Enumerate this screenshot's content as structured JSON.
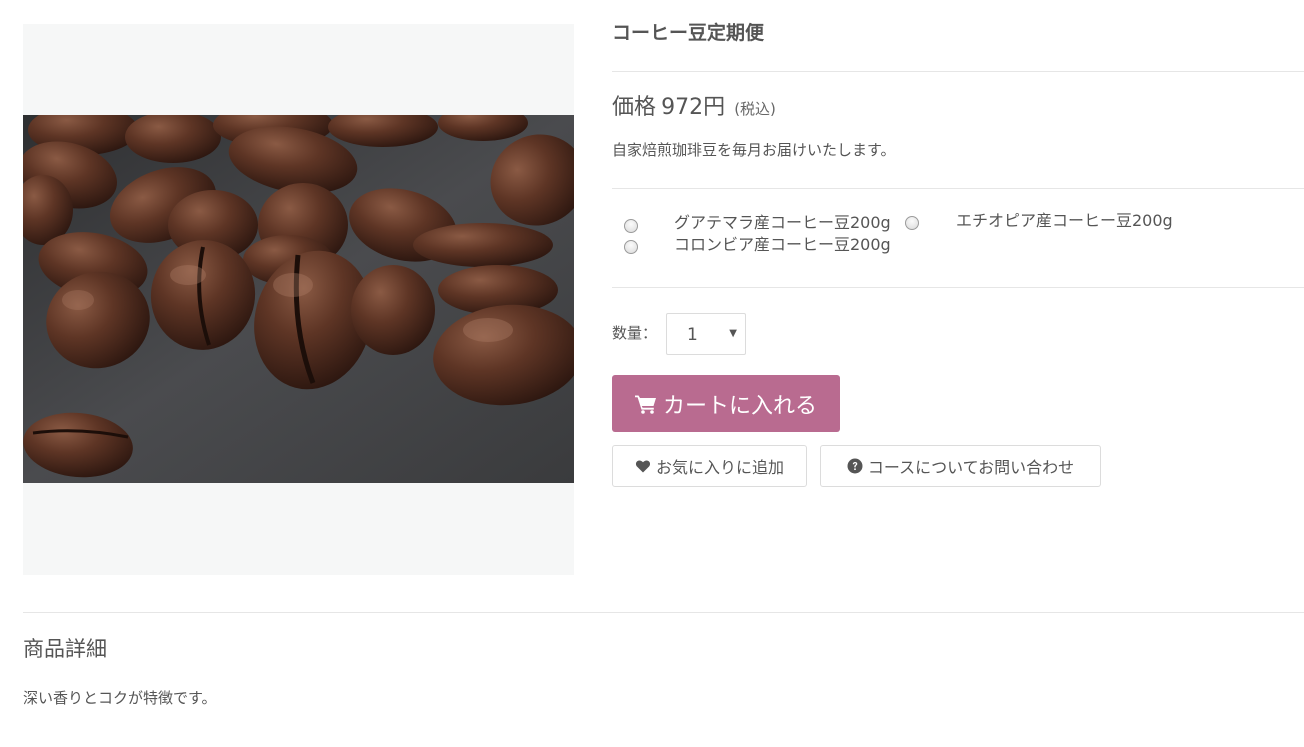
{
  "product": {
    "title": "コーヒー豆定期便",
    "image_alt": "coffee-beans-photo",
    "price_label": "価格",
    "price_value": "972円",
    "price_tax": "(税込)",
    "description": "自家焙煎珈琲豆を毎月お届けいたします。"
  },
  "options": [
    {
      "label": "グアテマラ産コーヒー豆200g",
      "selected": false
    },
    {
      "label": "エチオピア産コーヒー豆200g",
      "selected": false
    },
    {
      "label": "コロンビア産コーヒー豆200g",
      "selected": false
    }
  ],
  "quantity": {
    "label": "数量：",
    "value": "1"
  },
  "buttons": {
    "cart": "カートに入れる",
    "cart_icon": "shopping-cart-icon",
    "favorite": "お気に入りに追加",
    "favorite_icon": "heart-icon",
    "inquiry": "コースについてお問い合わせ",
    "inquiry_icon": "question-circle-icon"
  },
  "details": {
    "heading": "商品詳細",
    "text": "深い香りとコクが特徴です。"
  },
  "colors": {
    "accent": "#b96b90",
    "text": "#555555",
    "border": "#dcdcdc",
    "image_background": "#f6f7f7"
  }
}
